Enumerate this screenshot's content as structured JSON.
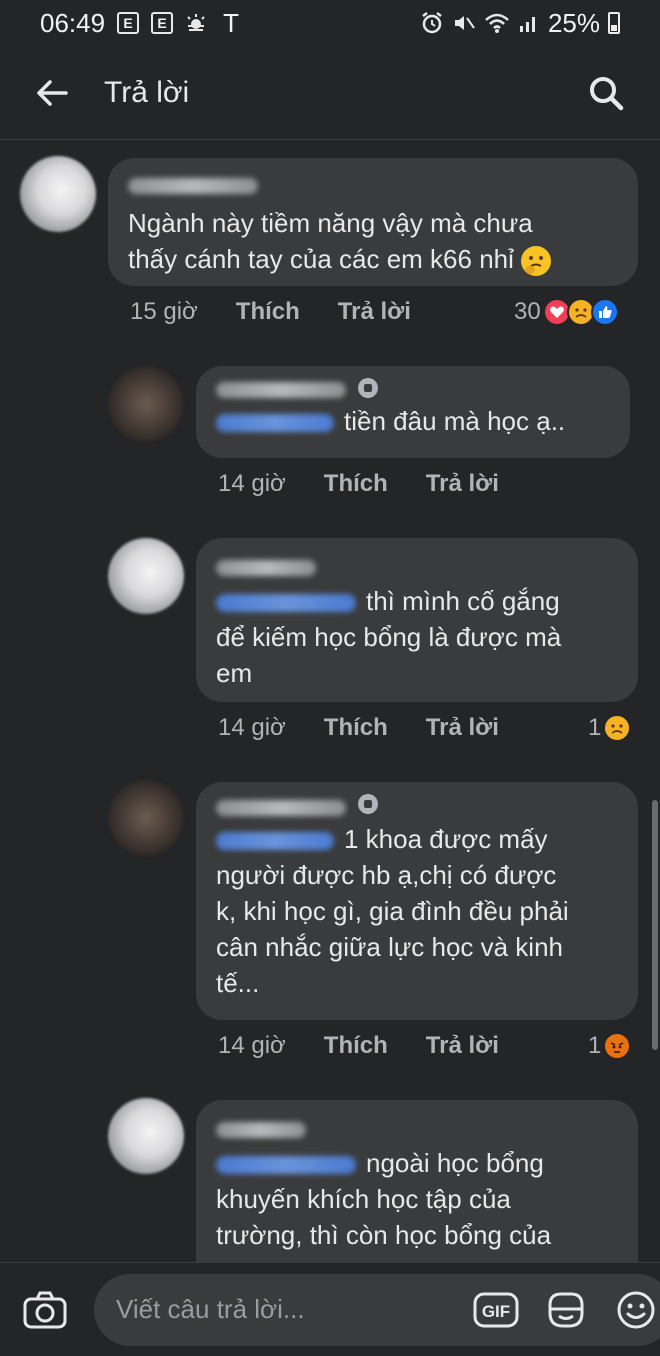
{
  "status_bar": {
    "time": "06:49",
    "battery": "25%",
    "left_icons": [
      "E",
      "E",
      "cloud-sun",
      "T"
    ],
    "right_icons": [
      "alarm-icon",
      "mute-icon",
      "wifi-icon",
      "signal-icon",
      "battery-icon"
    ]
  },
  "header": {
    "title": "Trả lời"
  },
  "comments": [
    {
      "text_line1": "Ngành này tiềm năng vậy mà chưa",
      "text_line2": "thấy cánh tay của các em k66 nhỉ",
      "time": "15 giờ",
      "like": "Thích",
      "reply": "Trả lời",
      "reaction_count": "30",
      "reactions": [
        "love",
        "sad",
        "like"
      ]
    },
    {
      "text": "tiền đâu mà học ạ..",
      "time": "14 giờ",
      "like": "Thích",
      "reply": "Trả lời"
    },
    {
      "text_line1": "thì mình cố gắng",
      "text_line2": "để kiếm học bổng là được mà",
      "text_line3": "em",
      "time": "14 giờ",
      "like": "Thích",
      "reply": "Trả lời",
      "reaction_count": "1",
      "reactions": [
        "sad"
      ]
    },
    {
      "text_line1": "1 khoa được mấy",
      "text_line2": "người được hb ạ,chị có được",
      "text_line3": "k, khi học gì, gia đình đều phải",
      "text_line4": "cân nhắc giữa lực học và kinh",
      "text_line5": "tế...",
      "time": "14 giờ",
      "like": "Thích",
      "reply": "Trả lời",
      "reaction_count": "1",
      "reactions": [
        "angry"
      ]
    },
    {
      "text_line1": "ngoài học bổng",
      "text_line2": "khuyến khích học tập của",
      "text_line3": "trường, thì còn học bổng của"
    }
  ],
  "composer": {
    "placeholder": "Viết câu trả lời...",
    "gif_label": "GIF"
  },
  "colors": {
    "background": "#242527",
    "bubble": "#3a3b3c",
    "meta": "#b0b3b8",
    "text": "#e8e8e8"
  }
}
